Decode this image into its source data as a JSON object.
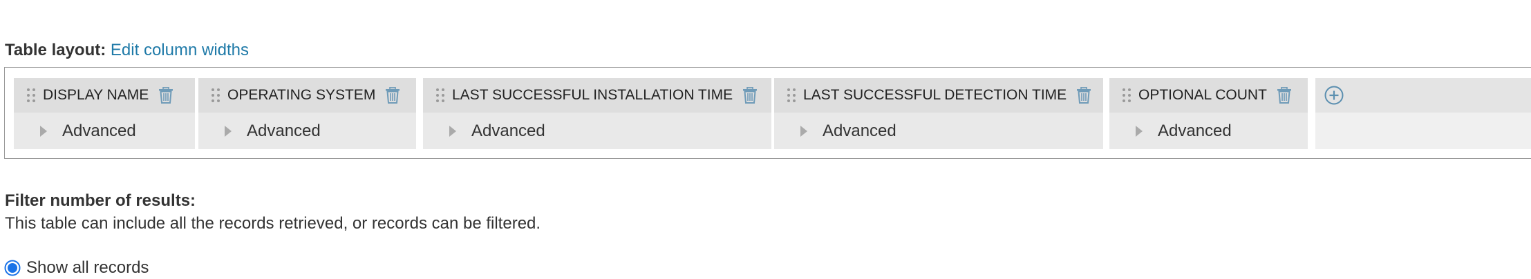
{
  "table_layout": {
    "label": "Table layout:",
    "edit_link": "Edit column widths"
  },
  "columns": [
    {
      "title": "DISPLAY NAME",
      "advanced": "Advanced"
    },
    {
      "title": "OPERATING SYSTEM",
      "advanced": "Advanced"
    },
    {
      "title": "LAST SUCCESSFUL INSTALLATION TIME",
      "advanced": "Advanced"
    },
    {
      "title": "LAST SUCCESSFUL DETECTION TIME",
      "advanced": "Advanced"
    },
    {
      "title": "OPTIONAL COUNT",
      "advanced": "Advanced"
    }
  ],
  "filter": {
    "title": "Filter number of results:",
    "description": "This table can include all the records retrieved, or records can be filtered.",
    "options": [
      {
        "label": "Show all records",
        "selected": true
      }
    ]
  },
  "icons": {
    "drag": "drag-handle-icon",
    "delete": "trash-icon",
    "expand": "caret-right-icon",
    "add": "plus-circle-icon"
  },
  "colors": {
    "link": "#1f7aa8",
    "icon": "#5b8fb0",
    "radio": "#1a73e8",
    "header_bg": "#dedede",
    "body_bg": "#e9e9e9"
  }
}
